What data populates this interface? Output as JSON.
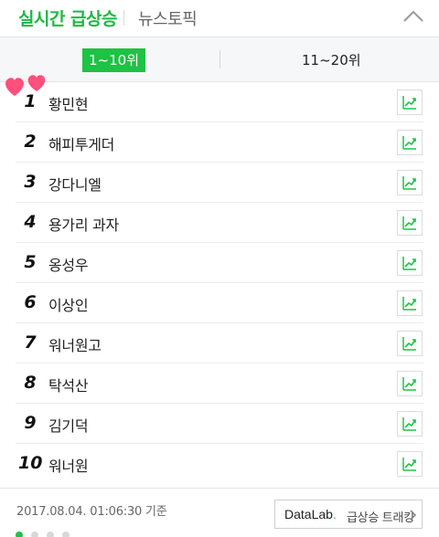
{
  "header": {
    "tab_main": "실시간 급상승",
    "tab_news": "뉴스토픽"
  },
  "range": {
    "active": "1~10위",
    "other": "11~20위"
  },
  "ranks": [
    {
      "num": "1",
      "keyword": "황민현"
    },
    {
      "num": "2",
      "keyword": "해피투게더"
    },
    {
      "num": "3",
      "keyword": "강다니엘"
    },
    {
      "num": "4",
      "keyword": "용가리 과자"
    },
    {
      "num": "5",
      "keyword": "옹성우"
    },
    {
      "num": "6",
      "keyword": "이상인"
    },
    {
      "num": "7",
      "keyword": "워너원고"
    },
    {
      "num": "8",
      "keyword": "탁석산"
    },
    {
      "num": "9",
      "keyword": "김기덕"
    },
    {
      "num": "10",
      "keyword": "워너원"
    }
  ],
  "footer": {
    "timestamp": "2017.08.04. 01:06:30 기준",
    "datalab_brand": "DataLab",
    "datalab_dot": ".",
    "datalab_text": "급상승 트래킹"
  },
  "pagination": {
    "total": 4,
    "active": 1
  },
  "colors": {
    "accent": "#1ec244",
    "heart": "#ff4f7b"
  },
  "icons": {
    "collapse": "chevron-up-icon",
    "trend": "trend-chart-icon",
    "decoration": "hearts-icon",
    "more": "chevron-right-icon"
  }
}
